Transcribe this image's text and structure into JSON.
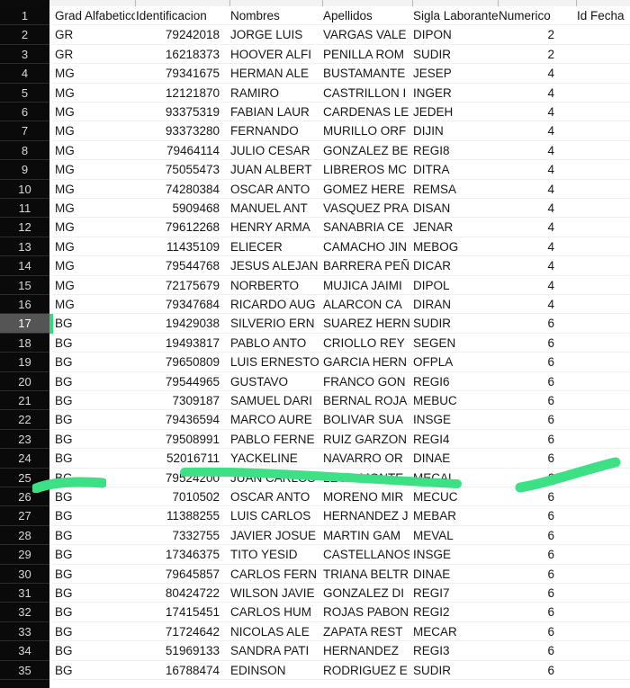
{
  "spreadsheet": {
    "columns": [
      {
        "key": "grad",
        "label": "Grad Alfabetico"
      },
      {
        "key": "ident",
        "label": "Identificacion"
      },
      {
        "key": "nomb",
        "label": "Nombres"
      },
      {
        "key": "apell",
        "label": "Apellidos"
      },
      {
        "key": "sigla",
        "label": "Sigla Laborante"
      },
      {
        "key": "numer",
        "label": "Numerico"
      },
      {
        "key": "idfec",
        "label": "Id Fecha"
      }
    ],
    "header_row_number": "1",
    "selected_row_number": "17",
    "row_numbers": [
      "1",
      "2",
      "3",
      "4",
      "5",
      "6",
      "7",
      "8",
      "9",
      "10",
      "11",
      "12",
      "13",
      "14",
      "15",
      "16",
      "17",
      "18",
      "19",
      "20",
      "21",
      "22",
      "23",
      "24",
      "25",
      "26",
      "27",
      "28",
      "29",
      "30",
      "31",
      "32",
      "33",
      "34",
      "35"
    ],
    "rows": [
      {
        "n": "2",
        "grad": "GR",
        "ident": "79242018",
        "nomb": "JORGE LUIS",
        "apell": "VARGAS VALE",
        "sigla": "DIPON",
        "numer": "2",
        "idfec": ""
      },
      {
        "n": "3",
        "grad": "GR",
        "ident": "16218373",
        "nomb": "HOOVER ALFI",
        "apell": "PENILLA ROM",
        "sigla": "SUDIR",
        "numer": "2",
        "idfec": ""
      },
      {
        "n": "4",
        "grad": "MG",
        "ident": "79341675",
        "nomb": "HERMAN ALE",
        "apell": "BUSTAMANTE",
        "sigla": "JESEP",
        "numer": "4",
        "idfec": ""
      },
      {
        "n": "5",
        "grad": "MG",
        "ident": "12121870",
        "nomb": "RAMIRO",
        "apell": "CASTRILLON I",
        "sigla": "INGER",
        "numer": "4",
        "idfec": ""
      },
      {
        "n": "6",
        "grad": "MG",
        "ident": "93375319",
        "nomb": "FABIAN LAUR",
        "apell": "CARDENAS LE",
        "sigla": "JEDEH",
        "numer": "4",
        "idfec": ""
      },
      {
        "n": "7",
        "grad": "MG",
        "ident": "93373280",
        "nomb": "FERNANDO",
        "apell": "MURILLO ORF",
        "sigla": "DIJIN",
        "numer": "4",
        "idfec": ""
      },
      {
        "n": "8",
        "grad": "MG",
        "ident": "79464114",
        "nomb": "JULIO CESAR",
        "apell": "GONZALEZ BE",
        "sigla": "REGI8",
        "numer": "4",
        "idfec": ""
      },
      {
        "n": "9",
        "grad": "MG",
        "ident": "75055473",
        "nomb": "JUAN ALBERT",
        "apell": "LIBREROS MC",
        "sigla": "DITRA",
        "numer": "4",
        "idfec": ""
      },
      {
        "n": "10",
        "grad": "MG",
        "ident": "74280384",
        "nomb": "OSCAR ANTO",
        "apell": "GOMEZ HERE",
        "sigla": "REMSA",
        "numer": "4",
        "idfec": ""
      },
      {
        "n": "11",
        "grad": "MG",
        "ident": "5909468",
        "nomb": "MANUEL ANT",
        "apell": "VASQUEZ PRA",
        "sigla": "DISAN",
        "numer": "4",
        "idfec": ""
      },
      {
        "n": "12",
        "grad": "MG",
        "ident": "79612268",
        "nomb": "HENRY ARMA",
        "apell": "SANABRIA CE",
        "sigla": "JENAR",
        "numer": "4",
        "idfec": ""
      },
      {
        "n": "13",
        "grad": "MG",
        "ident": "11435109",
        "nomb": "ELIECER",
        "apell": "CAMACHO JIN",
        "sigla": "MEBOG",
        "numer": "4",
        "idfec": ""
      },
      {
        "n": "14",
        "grad": "MG",
        "ident": "79544768",
        "nomb": "JESUS ALEJAN",
        "apell": "BARRERA PEÑ",
        "sigla": "DICAR",
        "numer": "4",
        "idfec": ""
      },
      {
        "n": "15",
        "grad": "MG",
        "ident": "72175679",
        "nomb": "NORBERTO",
        "apell": "MUJICA JAIMI",
        "sigla": "DIPOL",
        "numer": "4",
        "idfec": ""
      },
      {
        "n": "16",
        "grad": "MG",
        "ident": "79347684",
        "nomb": "RICARDO AUG",
        "apell": "ALARCON CA",
        "sigla": "DIRAN",
        "numer": "4",
        "idfec": ""
      },
      {
        "n": "17",
        "grad": "BG",
        "ident": "19429038",
        "nomb": "SILVERIO ERN",
        "apell": "SUAREZ HERN",
        "sigla": "SUDIR",
        "numer": "6",
        "idfec": ""
      },
      {
        "n": "18",
        "grad": "BG",
        "ident": "19493817",
        "nomb": "PABLO ANTO",
        "apell": "CRIOLLO REY",
        "sigla": "SEGEN",
        "numer": "6",
        "idfec": ""
      },
      {
        "n": "19",
        "grad": "BG",
        "ident": "79650809",
        "nomb": "LUIS ERNESTO",
        "apell": "GARCIA HERN",
        "sigla": "OFPLA",
        "numer": "6",
        "idfec": ""
      },
      {
        "n": "20",
        "grad": "BG",
        "ident": "79544965",
        "nomb": "GUSTAVO",
        "apell": "FRANCO GON",
        "sigla": "REGI6",
        "numer": "6",
        "idfec": ""
      },
      {
        "n": "21",
        "grad": "BG",
        "ident": "7309187",
        "nomb": "SAMUEL DARI",
        "apell": "BERNAL ROJA",
        "sigla": "MEBUC",
        "numer": "6",
        "idfec": ""
      },
      {
        "n": "22",
        "grad": "BG",
        "ident": "79436594",
        "nomb": "MARCO AURE",
        "apell": "BOLIVAR SUA",
        "sigla": "INSGE",
        "numer": "6",
        "idfec": ""
      },
      {
        "n": "23",
        "grad": "BG",
        "ident": "79508991",
        "nomb": "PABLO FERNE",
        "apell": "RUIZ GARZON",
        "sigla": "REGI4",
        "numer": "6",
        "idfec": ""
      },
      {
        "n": "24",
        "grad": "BG",
        "ident": "52016711",
        "nomb": "YACKELINE",
        "apell": "NAVARRO OR",
        "sigla": "DINAE",
        "numer": "6",
        "idfec": ""
      },
      {
        "n": "25",
        "grad": "BG",
        "ident": "79524200",
        "nomb": "JUAN CARLOS",
        "apell": "LEON MONTE",
        "sigla": "MECAL",
        "numer": "6",
        "idfec": ""
      },
      {
        "n": "26",
        "grad": "BG",
        "ident": "7010502",
        "nomb": "OSCAR ANTO",
        "apell": "MORENO MIR",
        "sigla": "MECUC",
        "numer": "6",
        "idfec": ""
      },
      {
        "n": "27",
        "grad": "BG",
        "ident": "11388255",
        "nomb": "LUIS CARLOS",
        "apell": "HERNANDEZ J",
        "sigla": "MEBAR",
        "numer": "6",
        "idfec": ""
      },
      {
        "n": "28",
        "grad": "BG",
        "ident": "7332755",
        "nomb": "JAVIER JOSUE",
        "apell": "MARTIN GAM",
        "sigla": "MEVAL",
        "numer": "6",
        "idfec": ""
      },
      {
        "n": "29",
        "grad": "BG",
        "ident": "17346375",
        "nomb": "TITO YESID",
        "apell": "CASTELLANOS",
        "sigla": "INSGE",
        "numer": "6",
        "idfec": ""
      },
      {
        "n": "30",
        "grad": "BG",
        "ident": "79645857",
        "nomb": "CARLOS FERN",
        "apell": "TRIANA BELTR",
        "sigla": "DINAE",
        "numer": "6",
        "idfec": ""
      },
      {
        "n": "31",
        "grad": "BG",
        "ident": "80424722",
        "nomb": "WILSON JAVIE",
        "apell": "GONZALEZ DI",
        "sigla": "REGI7",
        "numer": "6",
        "idfec": ""
      },
      {
        "n": "32",
        "grad": "BG",
        "ident": "17415451",
        "nomb": "CARLOS HUM",
        "apell": "ROJAS PABON",
        "sigla": "REGI2",
        "numer": "6",
        "idfec": ""
      },
      {
        "n": "33",
        "grad": "BG",
        "ident": "71724642",
        "nomb": "NICOLAS ALE",
        "apell": "ZAPATA REST",
        "sigla": "MECAR",
        "numer": "6",
        "idfec": ""
      },
      {
        "n": "34",
        "grad": "BG",
        "ident": "51969133",
        "nomb": "SANDRA PATI",
        "apell": "HERNANDEZ",
        "sigla": "REGI3",
        "numer": "6",
        "idfec": ""
      },
      {
        "n": "35",
        "grad": "BG",
        "ident": "16788474",
        "nomb": "EDINSON",
        "apell": "RODRIGUEZ E",
        "sigla": "SUDIR",
        "numer": "6",
        "idfec": ""
      }
    ]
  },
  "annotations": {
    "highlighter_color": "#3ee085",
    "strokes": [
      {
        "name": "left-stroke",
        "target_row": "25"
      },
      {
        "name": "middle-stroke",
        "target_row": "24"
      },
      {
        "name": "right-stroke",
        "target_row": "24"
      }
    ]
  },
  "colors": {
    "gutter_background": "#0a0a0a",
    "gutter_text": "#d8d8d8",
    "selected_row_background": "#555555",
    "selection_indicator": "#36d97f",
    "grid_background": "#ffffff",
    "cell_text": "#171717"
  }
}
